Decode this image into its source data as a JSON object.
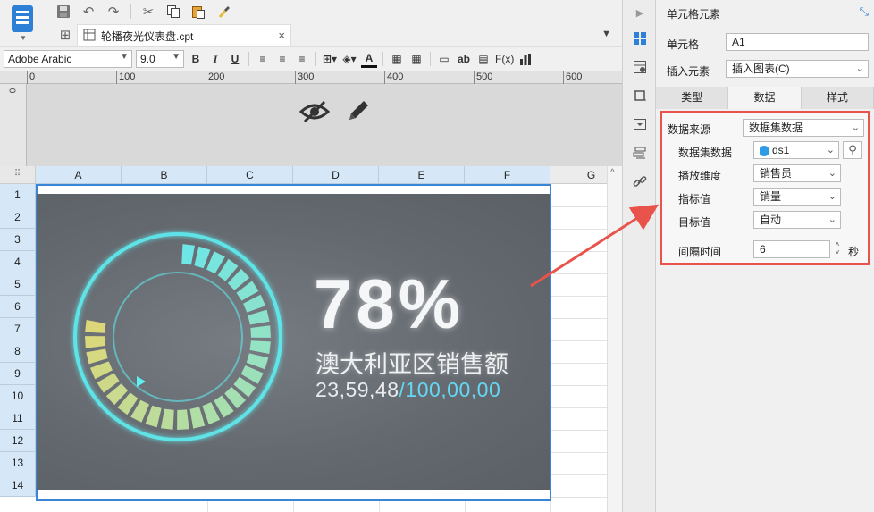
{
  "app": {
    "tab_title": "轮播夜光仪表盘.cpt",
    "close_glyph": "×"
  },
  "format_bar": {
    "font_name": "Adobe Arabic",
    "font_size": "9.0",
    "bold": "B",
    "italic": "I",
    "underline": "U",
    "text_color_label": "A",
    "ab_label": "ab",
    "fx_label": "F(x)"
  },
  "ruler": {
    "ticks": [
      "0",
      "100",
      "200",
      "300",
      "400",
      "500",
      "600"
    ],
    "vertical_zero": "0"
  },
  "grid": {
    "corner_glyph": "⠿",
    "columns": [
      "A",
      "B",
      "C",
      "D",
      "E",
      "F",
      "G"
    ],
    "rows": [
      "1",
      "2",
      "3",
      "4",
      "5",
      "6",
      "7",
      "8",
      "9",
      "10",
      "11",
      "12",
      "13",
      "14"
    ]
  },
  "chart": {
    "percent": "78%",
    "region_label": "澳大利亚区销售额",
    "actual": "23,59,48",
    "separator": "/",
    "target": "100,00,00",
    "progress": 0.78,
    "colors": {
      "ring": "#5ff0f4",
      "bar_start": "#e8e07a",
      "bar_end": "#6ff0f0"
    }
  },
  "panel": {
    "title": "单元格元素",
    "cell_label": "单元格",
    "cell_value": "A1",
    "insert_label": "插入元素",
    "insert_value": "插入图表(C)",
    "tabs": [
      "类型",
      "数据",
      "样式"
    ],
    "active_tab": "数据",
    "data_source_label": "数据来源",
    "data_source_value": "数据集数据",
    "dataset_label": "数据集数据",
    "dataset_value": "ds1",
    "carousel_dim_label": "播放维度",
    "carousel_dim_value": "销售员",
    "metric_label": "指标值",
    "metric_value": "销量",
    "target_label": "目标值",
    "target_value": "自动",
    "interval_label": "间隔时间",
    "interval_value": "6",
    "interval_unit": "秒"
  }
}
